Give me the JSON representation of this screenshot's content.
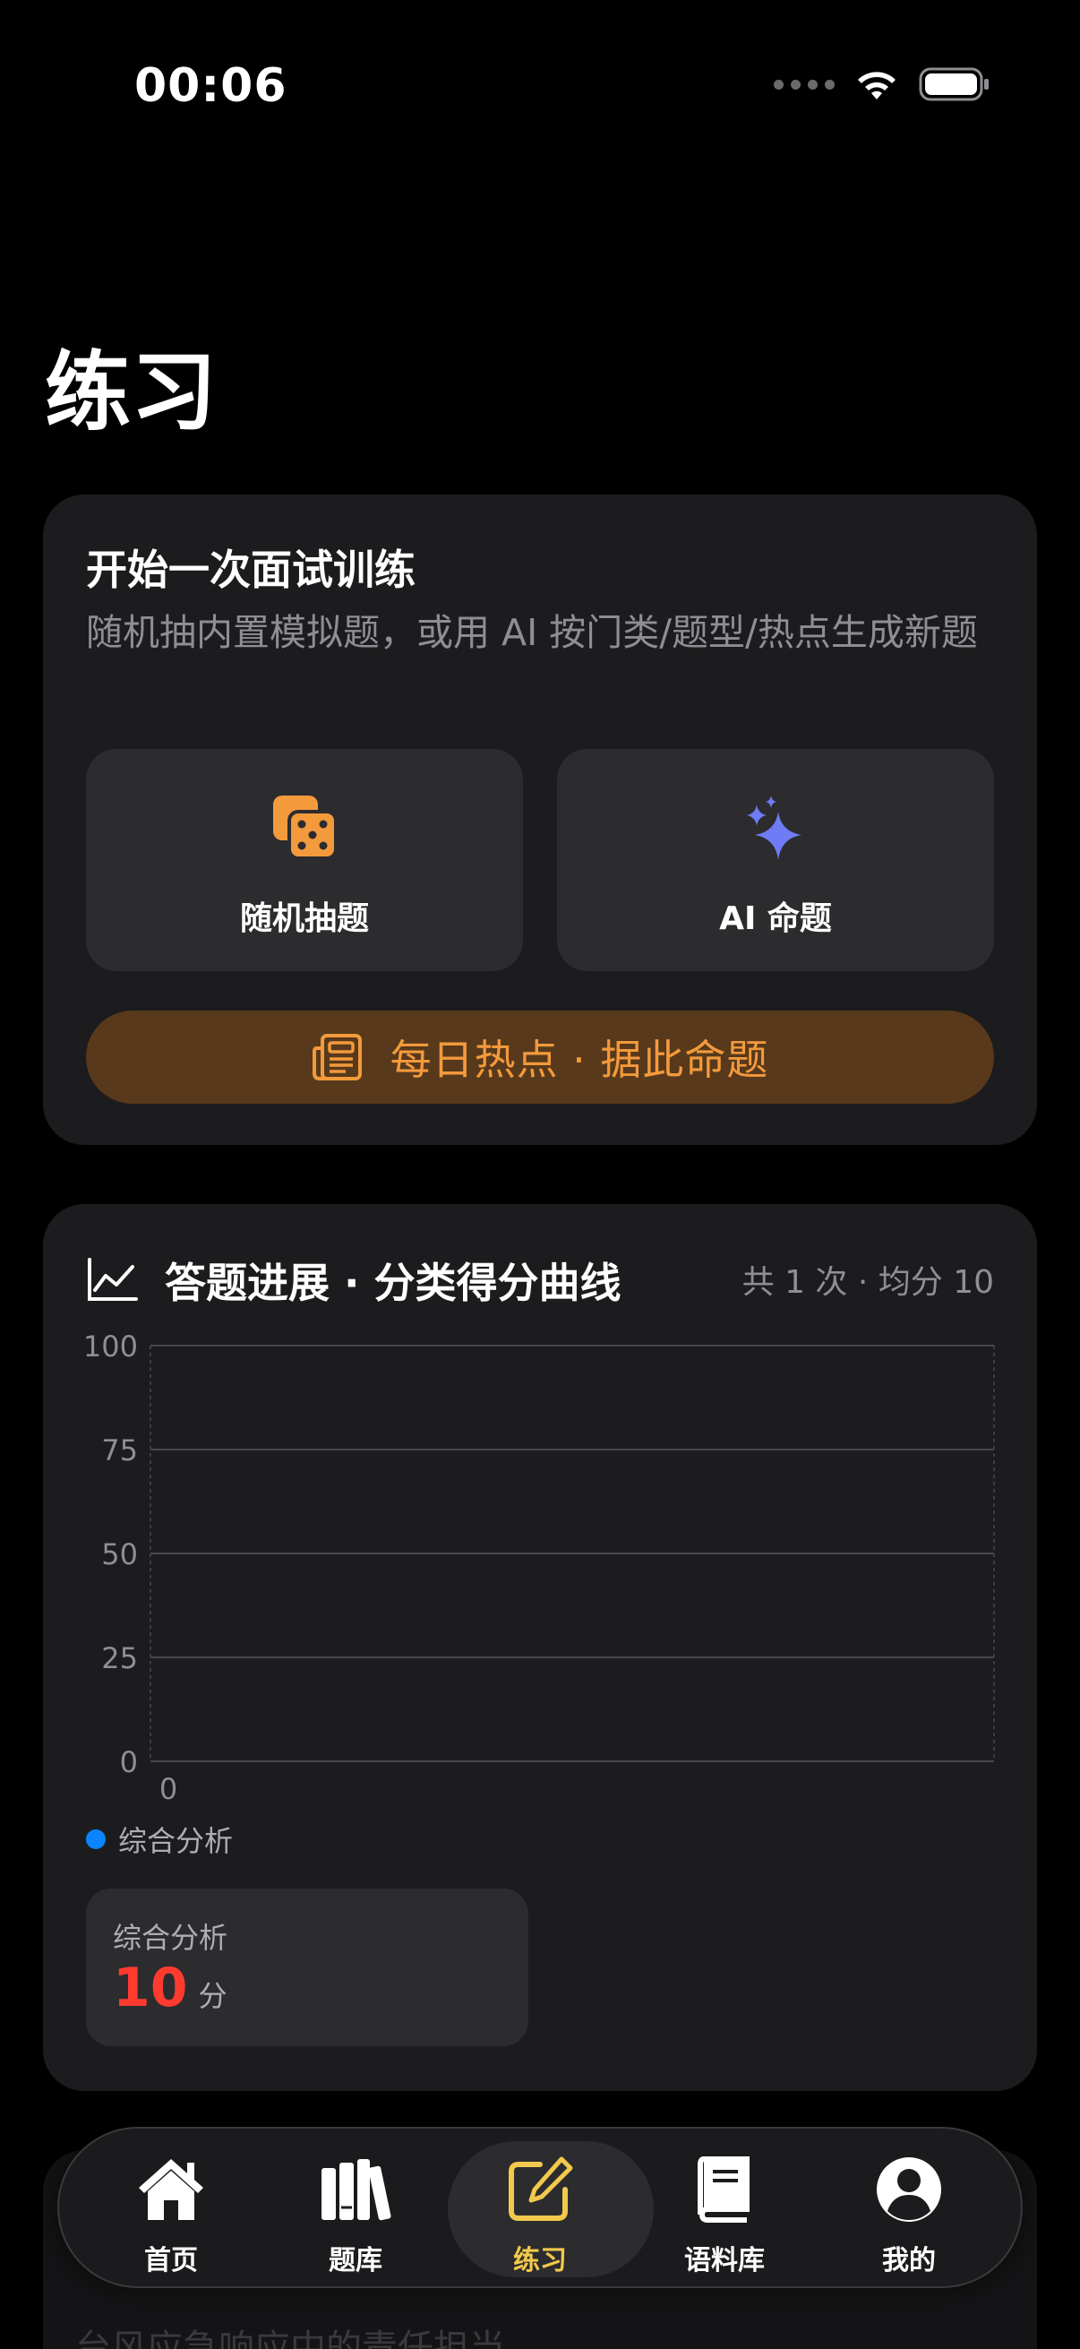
{
  "status_bar": {
    "time": "00:06"
  },
  "page": {
    "title": "练习"
  },
  "training": {
    "title": "开始一次面试训练",
    "subtitle": "随机抽内置模拟题，或用 AI 按门类/题型/热点生成新题",
    "random_label": "随机抽题",
    "ai_label": "AI 命题",
    "hot_label": "每日热点 · 据此命题"
  },
  "progress": {
    "title": "答题进展 · 分类得分曲线",
    "stats": "共 1 次 · 均分 10",
    "legend_label": "综合分析",
    "score_category": "综合分析",
    "score_value": "10",
    "score_unit": "分"
  },
  "chart_data": {
    "type": "line",
    "x": [
      0
    ],
    "x_tick_labels": [
      "0"
    ],
    "y_tick_labels": [
      "0",
      "25",
      "50",
      "75",
      "100"
    ],
    "ylim": [
      0,
      100
    ],
    "grid": true,
    "legend_position": "bottom-left",
    "series": [
      {
        "name": "综合分析",
        "color": "#0a84ff",
        "values": []
      }
    ]
  },
  "peek": {
    "text": "台风应急响应中的责任担当"
  },
  "tabs": [
    {
      "label": "首页",
      "icon": "house-icon"
    },
    {
      "label": "题库",
      "icon": "books-icon"
    },
    {
      "label": "练习",
      "icon": "pencil-square-icon"
    },
    {
      "label": "语料库",
      "icon": "book-icon"
    },
    {
      "label": "我的",
      "icon": "person-circle-icon"
    }
  ],
  "colors": {
    "accent": "#f2c94c",
    "orange": "#f39a3c",
    "ai_purple": "#6f7cf5",
    "score_red": "#ff3b30",
    "series_blue": "#0a84ff"
  }
}
